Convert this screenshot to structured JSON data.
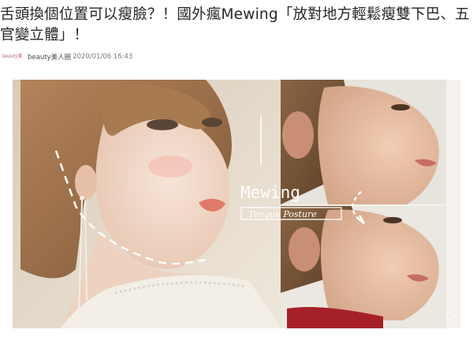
{
  "article": {
    "title": "舌頭換個位置可以瘦臉？！國外瘋Mewing「放對地方輕鬆瘦雙下巴、五官變立體」！",
    "source_logo_text": "beauty美人",
    "author": "beauty美人圈",
    "date": "2020/01/06 16:43"
  },
  "hero_image": {
    "overlay_title": "Mewing",
    "overlay_subtitle": "Tongue Posture"
  },
  "colors": {
    "overlay_text": "#ffffff",
    "overlay_box": "#ffffff",
    "dashed_line": "#ffffff"
  }
}
